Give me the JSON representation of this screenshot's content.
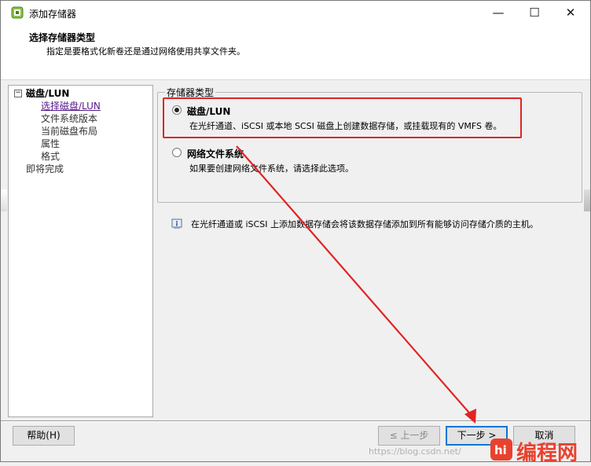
{
  "window": {
    "title": "添加存储器",
    "min_label": "—",
    "max_label": "☐",
    "close_label": "✕"
  },
  "header": {
    "title": "选择存储器类型",
    "subtitle": "指定是要格式化新卷还是通过网络使用共享文件夹。"
  },
  "nav": {
    "tree_toggle": "−",
    "root": "磁盘/LUN",
    "items": [
      {
        "label": "选择磁盘/LUN",
        "active": true
      },
      {
        "label": "文件系统版本",
        "active": false
      },
      {
        "label": "当前磁盘布局",
        "active": false
      },
      {
        "label": "属性",
        "active": false
      },
      {
        "label": "格式",
        "active": false
      }
    ],
    "finish": "即将完成"
  },
  "storage_type": {
    "legend": "存储器类型",
    "options": [
      {
        "title": "磁盘/LUN",
        "desc": "在光纤通道、iSCSI 或本地 SCSI 磁盘上创建数据存储，或挂载现有的 VMFS 卷。",
        "selected": true
      },
      {
        "title": "网络文件系统",
        "desc": "如果要创建网络文件系统，请选择此选项。",
        "selected": false
      }
    ]
  },
  "info": {
    "text": "在光纤通道或 iSCSI 上添加数据存储会将该数据存储添加到所有能够访问存储介质的主机。"
  },
  "buttons": {
    "help": "帮助(H)",
    "back": "≤ 上一步",
    "next": "下一步 >",
    "cancel": "取消"
  },
  "watermark": "https://blog.csdn.net/",
  "brand": {
    "logo": "编程网",
    "logo_mark": "hi"
  },
  "colors": {
    "highlight": "#e12424",
    "arrow": "#e12424",
    "link": "#551a8b"
  }
}
